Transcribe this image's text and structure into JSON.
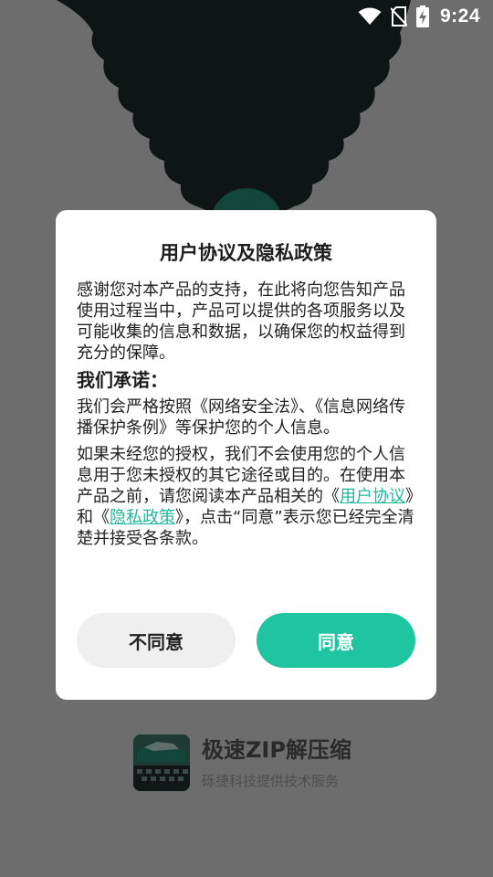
{
  "status_bar": {
    "time": "9:24",
    "icons": [
      "wifi-icon",
      "no-sim-icon",
      "battery-charging-icon"
    ]
  },
  "dialog": {
    "title": "用户协议及隐私政策",
    "intro": "感谢您对本产品的支持，在此将向您告知产品使用过程当中，产品可以提供的各项服务以及可能收集的信息和数据，以确保您的权益得到充分的保障。",
    "promise_heading": "我们承诺：",
    "promise_text": "我们会严格按照《网络安全法》、《信息网络传播保护条例》等保护您的个人信息。",
    "para3_start": "如果未经您的授权，我们不会使用您的个人信息用于您未授权的其它途径或目的。在使用本产品之前，请您阅读本产品相关的《",
    "user_agreement_link": "用户协议",
    "para3_mid": "》和《",
    "privacy_policy_link": "隐私政策",
    "para3_end": "》，点击“同意”表示您已经完全清楚并接受各条款。",
    "disagree_label": "不同意",
    "agree_label": "同意"
  },
  "brand": {
    "app_name": "极速ZIP解压缩",
    "subtitle": "砾捷科技提供技术服务"
  },
  "colors": {
    "overlay": "#6d6d6d",
    "accent": "#1fc4a0",
    "link": "#1fb89d",
    "dialog_bg": "#ffffff",
    "disagree_bg": "#efefef"
  }
}
